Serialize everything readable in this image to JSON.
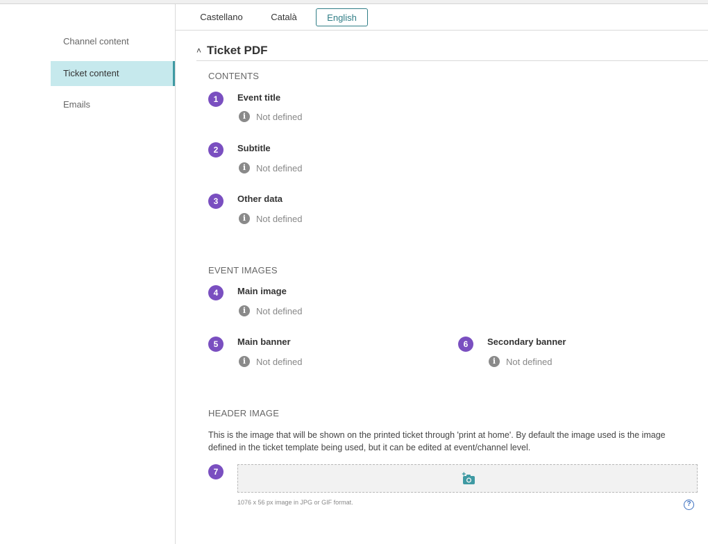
{
  "sidebar": {
    "items": [
      {
        "label": "Channel content"
      },
      {
        "label": "Ticket content"
      },
      {
        "label": "Emails"
      }
    ]
  },
  "languages": {
    "tabs": [
      {
        "label": "Castellano"
      },
      {
        "label": "Català"
      },
      {
        "label": "English"
      }
    ],
    "active": "English"
  },
  "section": {
    "title": "Ticket PDF",
    "collapse_icon": "chevron-up-icon"
  },
  "contents": {
    "label": "CONTENTS",
    "fields": [
      {
        "num": "1",
        "title": "Event title",
        "status": "Not defined"
      },
      {
        "num": "2",
        "title": "Subtitle",
        "status": "Not defined"
      },
      {
        "num": "3",
        "title": "Other data",
        "status": "Not defined"
      }
    ]
  },
  "event_images": {
    "label": "EVENT IMAGES",
    "fields": [
      {
        "num": "4",
        "title": "Main image",
        "status": "Not defined"
      },
      {
        "num": "5",
        "title": "Main banner",
        "status": "Not defined"
      },
      {
        "num": "6",
        "title": "Secondary banner",
        "status": "Not defined"
      }
    ]
  },
  "header_image": {
    "label": "HEADER IMAGE",
    "description": "This is the image that will be shown on the printed ticket through 'print at home'. By default the image used is the image defined in the ticket template being used, but it can be edited at event/channel level.",
    "num": "7",
    "upload_icon": "add-photo-icon",
    "hint": "1076 x 56 px image in JPG or GIF format.",
    "help_icon": "help-circle-icon",
    "help_glyph": "?"
  },
  "colors": {
    "accent": "#2f7d86",
    "active_bg": "#c6e9ed",
    "badge": "#7a4fc0",
    "help": "#3b6fbf"
  }
}
